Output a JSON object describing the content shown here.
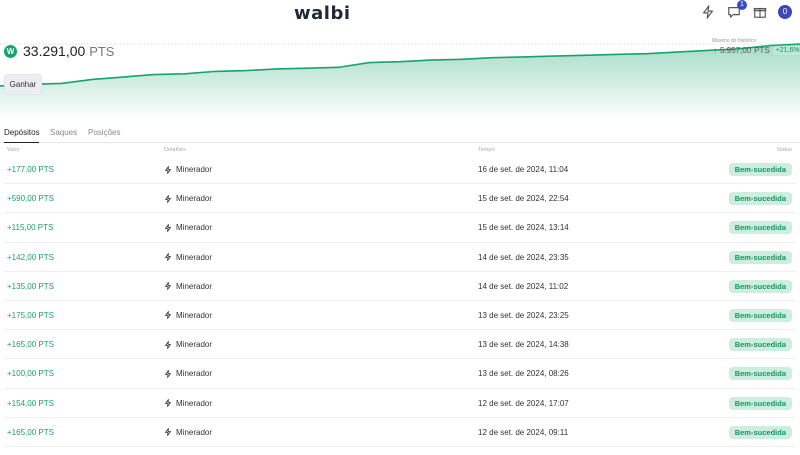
{
  "header": {
    "logo_text": "walbi",
    "icons": [
      "lightning-icon",
      "chat-icon",
      "gift-icon",
      "avatar"
    ],
    "notification_count": "1",
    "avatar_initial": "0"
  },
  "balance": {
    "value": "33.291,00",
    "unit": "PTS"
  },
  "chart_data": {
    "type": "area",
    "values": [
      20,
      22,
      23,
      28,
      31,
      34,
      35,
      38,
      39,
      41,
      42,
      43,
      49,
      50,
      52,
      53,
      55,
      56,
      57,
      58,
      59,
      60,
      62,
      64,
      66,
      70,
      72
    ],
    "peak_label": "Máximo do histórico",
    "peak_value": "5.957,00",
    "peak_unit": "PTS",
    "peak_change": "+21,6%"
  },
  "actions": {
    "earn_label": "Ganhar"
  },
  "tabs": [
    {
      "label": "Depósitos",
      "active": true
    },
    {
      "label": "Saques",
      "active": false
    },
    {
      "label": "Posições",
      "active": false
    }
  ],
  "table": {
    "columns": [
      "Valor",
      "Detalhes",
      "Tempo",
      "Status"
    ],
    "rows": [
      {
        "amount": "+177,00 PTS",
        "detail": "Minerador",
        "time": "16 de set. de 2024, 11:04",
        "status": "Bem-sucedida"
      },
      {
        "amount": "+590,00 PTS",
        "detail": "Minerador",
        "time": "15 de set. de 2024, 22:54",
        "status": "Bem-sucedida"
      },
      {
        "amount": "+115,00 PTS",
        "detail": "Minerador",
        "time": "15 de set. de 2024, 13:14",
        "status": "Bem-sucedida"
      },
      {
        "amount": "+142,00 PTS",
        "detail": "Minerador",
        "time": "14 de set. de 2024, 23:35",
        "status": "Bem-sucedida"
      },
      {
        "amount": "+135,00 PTS",
        "detail": "Minerador",
        "time": "14 de set. de 2024, 11:02",
        "status": "Bem-sucedida"
      },
      {
        "amount": "+175,00 PTS",
        "detail": "Minerador",
        "time": "13 de set. de 2024, 23:25",
        "status": "Bem-sucedida"
      },
      {
        "amount": "+165,00 PTS",
        "detail": "Minerador",
        "time": "13 de set. de 2024, 14:38",
        "status": "Bem-sucedida"
      },
      {
        "amount": "+100,00 PTS",
        "detail": "Minerador",
        "time": "13 de set. de 2024, 08:26",
        "status": "Bem-sucedida"
      },
      {
        "amount": "+154,00 PTS",
        "detail": "Minerador",
        "time": "12 de set. de 2024, 17:07",
        "status": "Bem-sucedida"
      },
      {
        "amount": "+165,00 PTS",
        "detail": "Minerador",
        "time": "12 de set. de 2024, 09:11",
        "status": "Bem-sucedida"
      }
    ]
  },
  "colors": {
    "accent": "#16a36d",
    "badge_bg": "#cdeedd",
    "badge_text": "#129565"
  }
}
